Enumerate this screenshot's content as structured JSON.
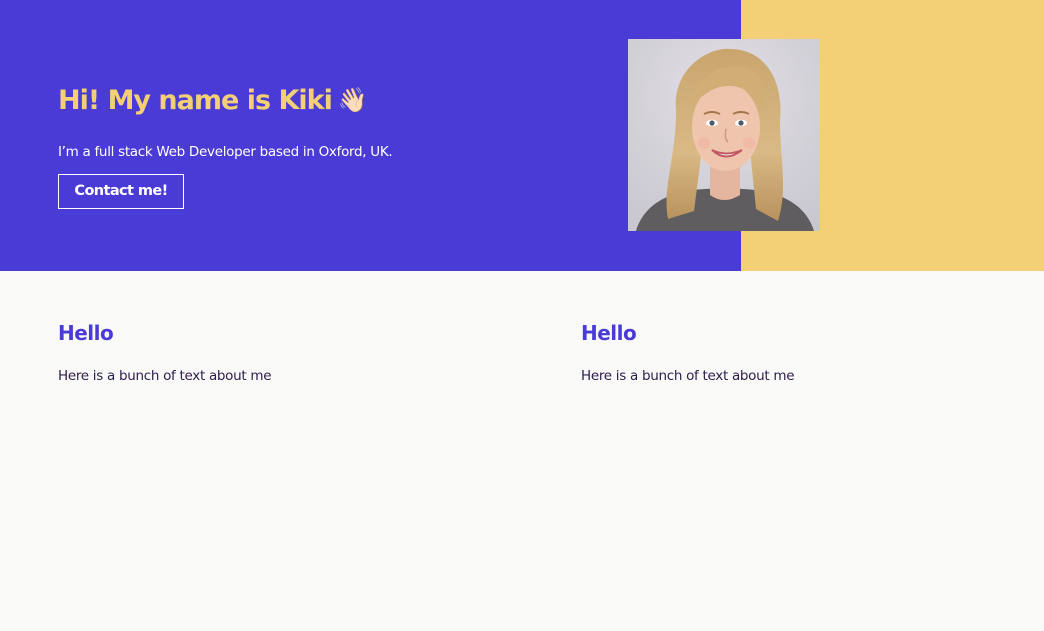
{
  "hero": {
    "title": "Hi! My name is Kiki",
    "wave_emoji": "👋🏻",
    "subtitle": "I’m a full stack Web Developer based in Oxford, UK.",
    "contact_label": "Contact me!",
    "portrait_icon": "portrait-photo"
  },
  "cards": [
    {
      "title": "Hello",
      "text": "Here is a bunch of text about me"
    },
    {
      "title": "Hello",
      "text": "Here is a bunch of text about me"
    }
  ],
  "colors": {
    "primary": "#4a3bd6",
    "accent": "#f3d076",
    "background": "#f9f9f8",
    "body_text": "#2c1d4a"
  }
}
